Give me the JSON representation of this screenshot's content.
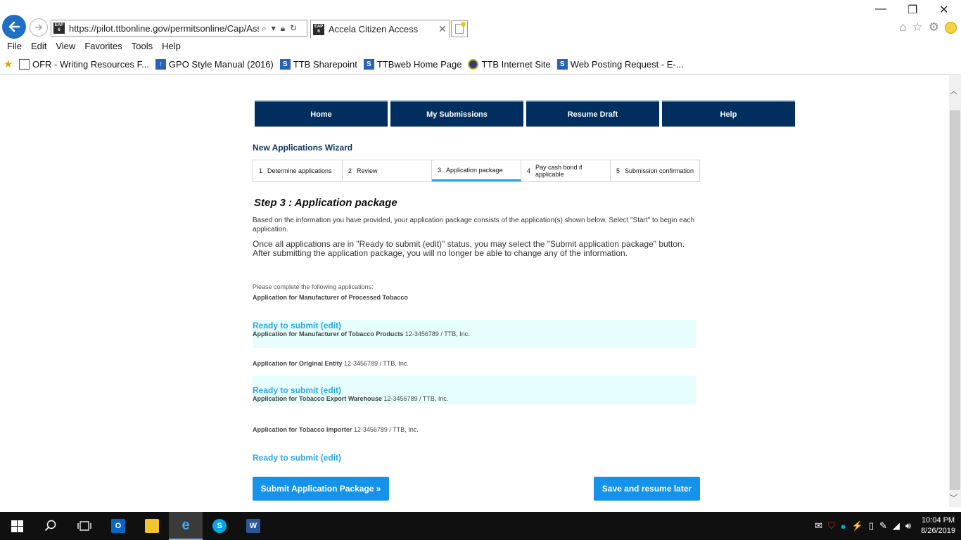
{
  "browser": {
    "url": "https://pilot.ttbonline.gov/permitsonline/Cap/Asso",
    "favicon_text": "EAP 6",
    "tab_title": "Accela Citizen Access",
    "menu": [
      "File",
      "Edit",
      "View",
      "Favorites",
      "Tools",
      "Help"
    ],
    "favorites": [
      {
        "label": "OFR - Writing Resources F...",
        "icon": "document-icon"
      },
      {
        "label": "GPO Style Manual (2016)",
        "icon": "gpo-icon"
      },
      {
        "label": "TTB Sharepoint",
        "icon": "sharepoint-icon"
      },
      {
        "label": "TTBweb Home Page",
        "icon": "sharepoint-icon"
      },
      {
        "label": "TTB Internet Site",
        "icon": "ttb-seal-icon"
      },
      {
        "label": "Web Posting Request - E-...",
        "icon": "sharepoint-icon"
      }
    ]
  },
  "nav": {
    "items": [
      "Home",
      "My Submissions",
      "Resume Draft",
      "Help"
    ]
  },
  "wizard": {
    "title": "New Applications Wizard",
    "steps": [
      {
        "num": "1",
        "label": "Determine applications"
      },
      {
        "num": "2",
        "label": "Review"
      },
      {
        "num": "3",
        "label": "Application package"
      },
      {
        "num": "4",
        "label": "Pay cash bond if applicable"
      },
      {
        "num": "5",
        "label": "Submission confirmation"
      }
    ],
    "active_step": 3
  },
  "step": {
    "title": "Step 3 : Application package",
    "intro": "Based on the information you have provided, your application package consists of the application(s) shown below. Select \"Start\" to begin each application.",
    "instructions": "Once all applications are in \"Ready to submit (edit)\" status, you may select the \"Submit application package\" button.  After submitting the application package, you will no longer be able to change any of the information.",
    "complete_label": "Please complete the following applications:",
    "first_application": "Application for Manufacturer of Processed Tobacco"
  },
  "applications": [
    {
      "status": "Ready to submit (edit)",
      "name": "Application for Manufacturer of Tobacco Products",
      "detail": "12-3456789 / TTB, Inc."
    },
    {
      "status": "",
      "name": "Application for Original Entity",
      "detail": "12-3456789 / TTB, Inc."
    },
    {
      "status": "Ready to submit (edit)",
      "name": "Application for Tobacco Export Warehouse",
      "detail": "12-3456789 / TTB, Inc."
    },
    {
      "status": "",
      "name": "Application for Tobacco Importer",
      "detail": "12-3456789 / TTB, Inc."
    },
    {
      "status": "Ready to submit (edit)",
      "name": "",
      "detail": ""
    }
  ],
  "buttons": {
    "submit": "Submit Application Package »",
    "save": "Save and resume later"
  },
  "taskbar": {
    "time": "10:04 PM",
    "date": "8/26/2019"
  },
  "colors": {
    "nav_bg": "#002f5f",
    "accent": "#2aa6e8",
    "button": "#1592ea",
    "highlight_row": "#e7feff"
  }
}
